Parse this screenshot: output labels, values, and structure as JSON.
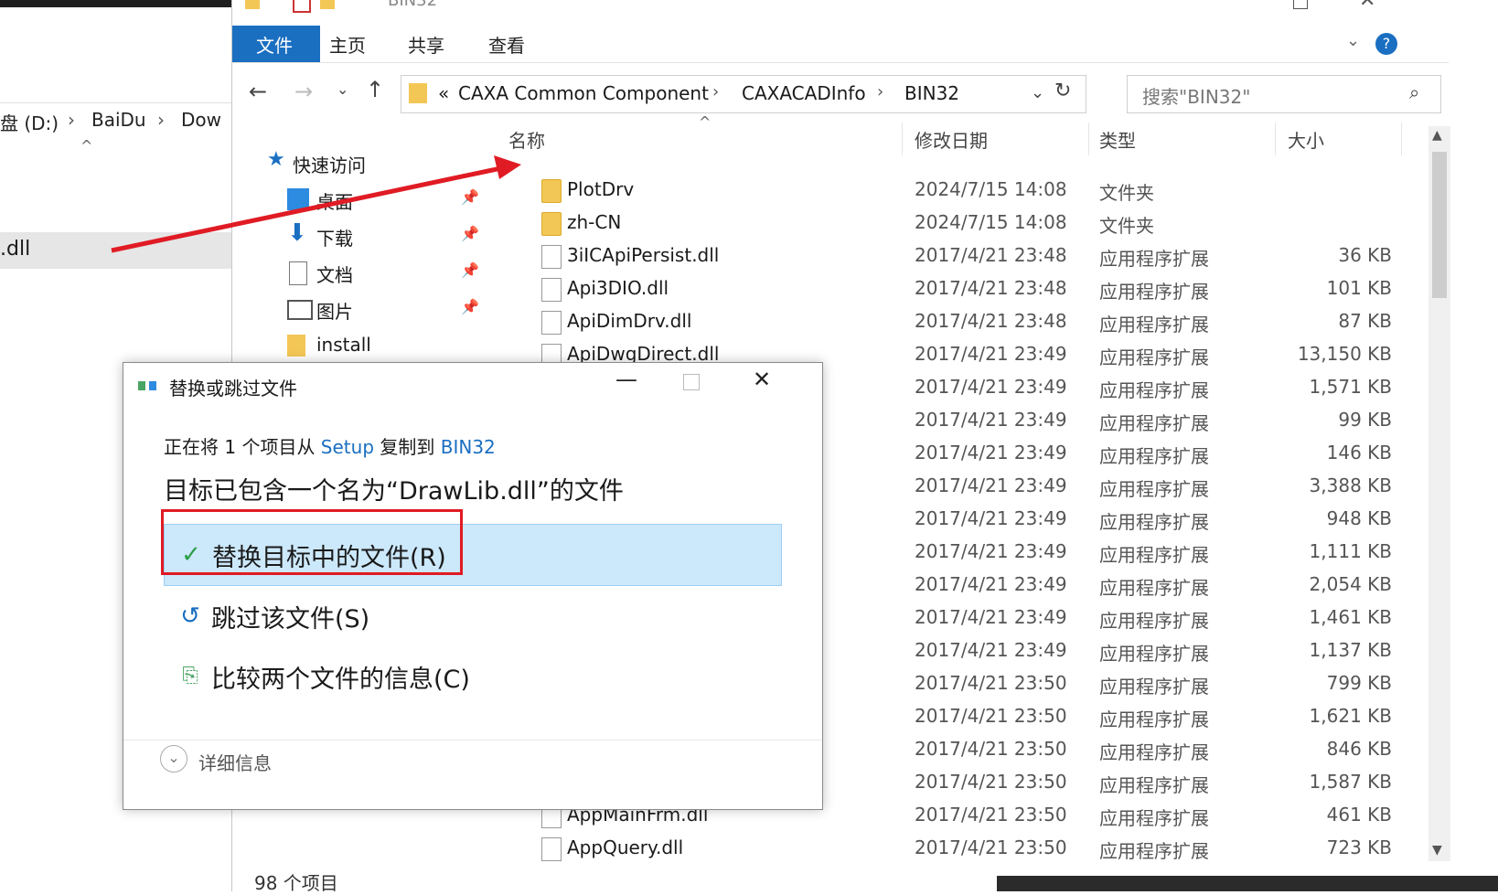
{
  "left_window": {
    "path": [
      "盘 (D:)",
      "BaiDu",
      "Dow"
    ],
    "selected_item": ".dll"
  },
  "explorer": {
    "title": "BIN32",
    "ribbon_tabs": [
      "文件",
      "主页",
      "共享",
      "查看"
    ],
    "breadcrumb": [
      "CAXA Common Component",
      "CAXACADInfo",
      "BIN32"
    ],
    "breadcrumb_overflow": "«",
    "search_placeholder": "搜索\"BIN32\"",
    "nav_pane": [
      {
        "label": "快速访问",
        "icon": "star-icon",
        "pinned": false
      },
      {
        "label": "桌面",
        "icon": "desktop-icon",
        "pinned": true
      },
      {
        "label": "下载",
        "icon": "download-icon",
        "pinned": true
      },
      {
        "label": "文档",
        "icon": "document-icon",
        "pinned": true
      },
      {
        "label": "图片",
        "icon": "picture-icon",
        "pinned": true
      },
      {
        "label": "install",
        "icon": "folder-icon",
        "pinned": false
      }
    ],
    "columns": [
      "名称",
      "修改日期",
      "类型",
      "大小"
    ],
    "files": [
      {
        "name": "PlotDrv",
        "date": "2024/7/15 14:08",
        "type": "文件夹",
        "size": "",
        "kind": "folder"
      },
      {
        "name": "zh-CN",
        "date": "2024/7/15 14:08",
        "type": "文件夹",
        "size": "",
        "kind": "folder"
      },
      {
        "name": "3iICApiPersist.dll",
        "date": "2017/4/21 23:48",
        "type": "应用程序扩展",
        "size": "36 KB",
        "kind": "dll"
      },
      {
        "name": "Api3DIO.dll",
        "date": "2017/4/21 23:48",
        "type": "应用程序扩展",
        "size": "101 KB",
        "kind": "dll"
      },
      {
        "name": "ApiDimDrv.dll",
        "date": "2017/4/21 23:48",
        "type": "应用程序扩展",
        "size": "87 KB",
        "kind": "dll"
      },
      {
        "name": "ApiDwgDirect.dll",
        "date": "2017/4/21 23:49",
        "type": "应用程序扩展",
        "size": "13,150 KB",
        "kind": "dll"
      },
      {
        "name": "",
        "date": "2017/4/21 23:49",
        "type": "应用程序扩展",
        "size": "1,571 KB",
        "kind": "hidden"
      },
      {
        "name": "",
        "date": "2017/4/21 23:49",
        "type": "应用程序扩展",
        "size": "99 KB",
        "kind": "hidden"
      },
      {
        "name": "",
        "date": "2017/4/21 23:49",
        "type": "应用程序扩展",
        "size": "146 KB",
        "kind": "hidden"
      },
      {
        "name": "",
        "date": "2017/4/21 23:49",
        "type": "应用程序扩展",
        "size": "3,388 KB",
        "kind": "hidden"
      },
      {
        "name": "",
        "date": "2017/4/21 23:49",
        "type": "应用程序扩展",
        "size": "948 KB",
        "kind": "hidden"
      },
      {
        "name": "",
        "date": "2017/4/21 23:49",
        "type": "应用程序扩展",
        "size": "1,111 KB",
        "kind": "hidden"
      },
      {
        "name": "",
        "date": "2017/4/21 23:49",
        "type": "应用程序扩展",
        "size": "2,054 KB",
        "kind": "hidden"
      },
      {
        "name": "",
        "date": "2017/4/21 23:49",
        "type": "应用程序扩展",
        "size": "1,461 KB",
        "kind": "hidden"
      },
      {
        "name": "",
        "date": "2017/4/21 23:49",
        "type": "应用程序扩展",
        "size": "1,137 KB",
        "kind": "hidden"
      },
      {
        "name": "",
        "date": "2017/4/21 23:50",
        "type": "应用程序扩展",
        "size": "799 KB",
        "kind": "hidden"
      },
      {
        "name": "",
        "date": "2017/4/21 23:50",
        "type": "应用程序扩展",
        "size": "1,621 KB",
        "kind": "hidden"
      },
      {
        "name": "",
        "date": "2017/4/21 23:50",
        "type": "应用程序扩展",
        "size": "846 KB",
        "kind": "hidden"
      },
      {
        "name": "",
        "date": "2017/4/21 23:50",
        "type": "应用程序扩展",
        "size": "1,587 KB",
        "kind": "hidden"
      },
      {
        "name": "AppMainFrm.dll",
        "date": "2017/4/21 23:50",
        "type": "应用程序扩展",
        "size": "461 KB",
        "kind": "dll"
      },
      {
        "name": "AppQuery.dll",
        "date": "2017/4/21 23:50",
        "type": "应用程序扩展",
        "size": "723 KB",
        "kind": "dll"
      }
    ],
    "status_count": "98 个项目"
  },
  "dialog": {
    "title": "替换或跳过文件",
    "line1_prefix": "正在将 1 个项目从 ",
    "line1_source": "Setup",
    "line1_mid": " 复制到 ",
    "line1_dest": "BIN32",
    "heading": "目标已包含一个名为“DrawLib.dll”的文件",
    "options": [
      {
        "label": "替换目标中的文件(R)",
        "icon": "checkmark-icon"
      },
      {
        "label": "跳过该文件(S)",
        "icon": "skip-icon"
      },
      {
        "label": "比较两个文件的信息(C)",
        "icon": "compare-files-icon"
      }
    ],
    "details": "详细信息"
  },
  "colors": {
    "accent": "#1a6fc1",
    "selection": "#cce8fb",
    "annotation_red": "#e01b24"
  }
}
